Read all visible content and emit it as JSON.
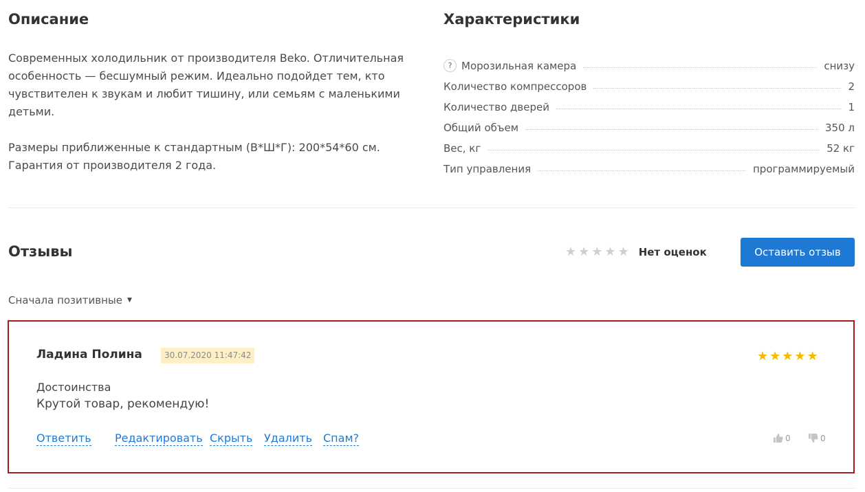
{
  "description": {
    "title": "Описание",
    "paragraph1": "Современных холодильник от производителя Beko. Отличительная особенность — бесшумный режим. Идеально подойдет тем, кто чувствителен к звукам и любит тишину, или семьям с маленькими детьми.",
    "paragraph2_line1": "Размеры приближенные к стандартным (В*Ш*Г): 200*54*60 см.",
    "paragraph2_line2": "Гарантия от производителя 2 года."
  },
  "characteristics": {
    "title": "Характеристики",
    "help_icon": "question-mark-icon",
    "help_glyph": "?",
    "rows": [
      {
        "name": "Морозильная камера",
        "value": "снизу"
      },
      {
        "name": "Количество компрессоров",
        "value": "2"
      },
      {
        "name": "Количество дверей",
        "value": "1"
      },
      {
        "name": "Общий объем",
        "value": "350 л"
      },
      {
        "name": "Вес, кг",
        "value": "52 кг"
      },
      {
        "name": "Тип управления",
        "value": "программируемый"
      }
    ]
  },
  "reviews": {
    "title": "Отзывы",
    "summary_rating": 0,
    "summary_rating_max": 5,
    "no_rating_label": "Нет оценок",
    "leave_review_label": "Оставить отзыв",
    "sort_label": "Сначала позитивные",
    "items": [
      {
        "author": "Ладина Полина",
        "date": "30.07.2020 11:47:42",
        "rating": 5,
        "rating_max": 5,
        "pros_label": "Достоинства",
        "pros_text": "Крутой товар, рекомендую!",
        "actions": {
          "reply": "Ответить",
          "edit": "Редактировать",
          "hide": "Скрыть",
          "delete": "Удалить",
          "spam": "Спам?"
        },
        "likes": "0",
        "dislikes": "0"
      }
    ]
  },
  "colors": {
    "accent": "#1e79d4",
    "star_filled": "#f5b900",
    "star_empty": "#cfcfcf",
    "review_border": "#a31d1d",
    "date_bg": "#fcf0c4"
  }
}
